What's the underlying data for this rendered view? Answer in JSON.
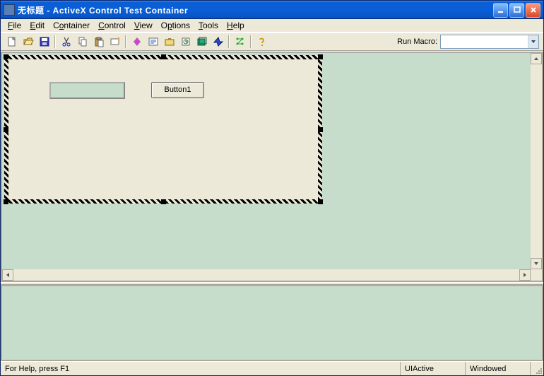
{
  "title": "无标题 - ActiveX Control Test Container",
  "menu": {
    "file": "File",
    "edit": "Edit",
    "container": "Container",
    "control": "Control",
    "view": "View",
    "options": "Options",
    "tools": "Tools",
    "help": "Help"
  },
  "toolbar": {
    "run_macro_label": "Run Macro:",
    "run_macro_value": ""
  },
  "form": {
    "input_value": "",
    "button1_label": "Button1"
  },
  "status": {
    "help": "For Help, press F1",
    "uiactive": "UIActive",
    "windowed": "Windowed"
  }
}
